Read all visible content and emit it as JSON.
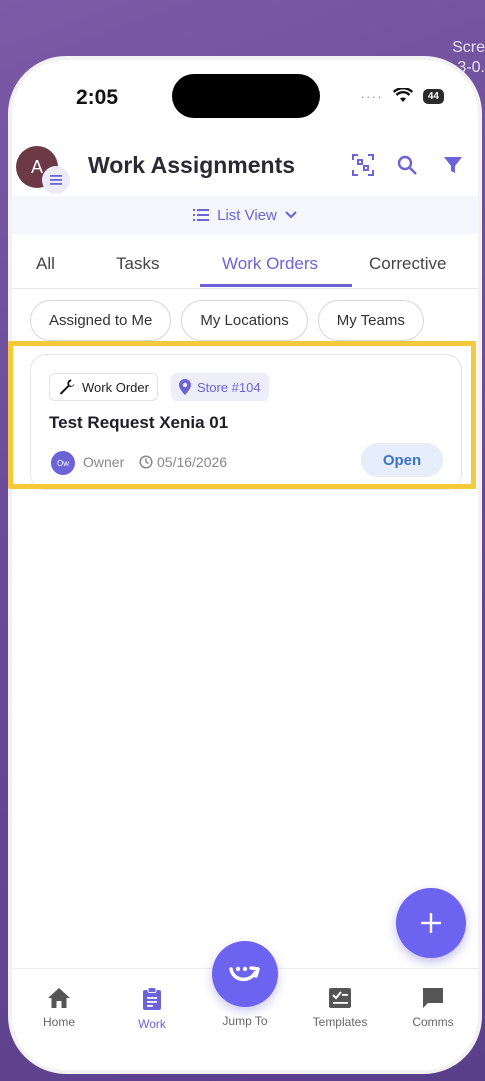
{
  "edge_text": [
    "Scre",
    "3-0."
  ],
  "status_bar": {
    "time": "2:05",
    "battery": "44"
  },
  "header": {
    "avatar_initial": "A",
    "title": "Work Assignments"
  },
  "view_toggle": {
    "label": "List View"
  },
  "tabs": [
    {
      "label": "All",
      "active": false
    },
    {
      "label": "Tasks",
      "active": false
    },
    {
      "label": "Work Orders",
      "active": true
    },
    {
      "label": "Corrective",
      "active": false
    }
  ],
  "filters": [
    "Assigned to Me",
    "My Locations",
    "My Teams"
  ],
  "work_order": {
    "type": "Work Order",
    "location": "Store #104",
    "title": "Test Request Xenia 01",
    "owner_initials": "Ow",
    "owner_label": "Owner",
    "date": "05/16/2026",
    "status": "Open"
  },
  "bottom_nav": {
    "home": "Home",
    "work": "Work",
    "jump": "Jump To",
    "templates": "Templates",
    "comms": "Comms"
  },
  "colors": {
    "accent": "#6c63d8",
    "highlight": "#f5c93a"
  }
}
